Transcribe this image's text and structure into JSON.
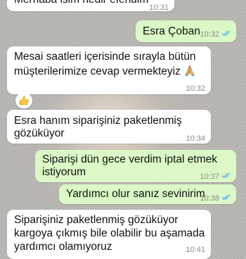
{
  "chat": {
    "messages": [
      {
        "direction": "incoming",
        "text": "Merhaba isim nedir efendim",
        "time": "10:31"
      },
      {
        "direction": "outgoing",
        "text": "Esra Çoban",
        "time": "10:32",
        "status": "read"
      },
      {
        "direction": "incoming",
        "lines": [
          "Mesai saatleri içerisinde sırayla bütün",
          "müşterilerimize cevap vermekteyiz"
        ],
        "emoji": "praying-hands-icon",
        "time": "10:32"
      },
      {
        "direction": "incoming",
        "reaction_icon": "thumbs-up-icon",
        "lines": [
          "Esra hanım siparişiniz paketlenmiş",
          "gözüküyor"
        ],
        "time": "10:34"
      },
      {
        "direction": "outgoing",
        "lines": [
          "Siparişi dün gece verdim iptal etmek",
          "istiyorum"
        ],
        "time": "10:37",
        "status": "read"
      },
      {
        "direction": "outgoing",
        "text": "Yardımcı olur sanız sevinirim",
        "time": "10:38",
        "status": "read"
      },
      {
        "direction": "incoming",
        "lines": [
          "Siparişiniz paketlenmiş gözüküyor",
          "kargoya çıkmış bile olabilir bu aşamada",
          "yardımcı olamıyoruz"
        ],
        "time": "10:41"
      }
    ]
  },
  "colors": {
    "incoming_bubble": "#ffffff",
    "outgoing_bubble": "#dbf8c6",
    "read_ticks": "#4fb6ec"
  }
}
